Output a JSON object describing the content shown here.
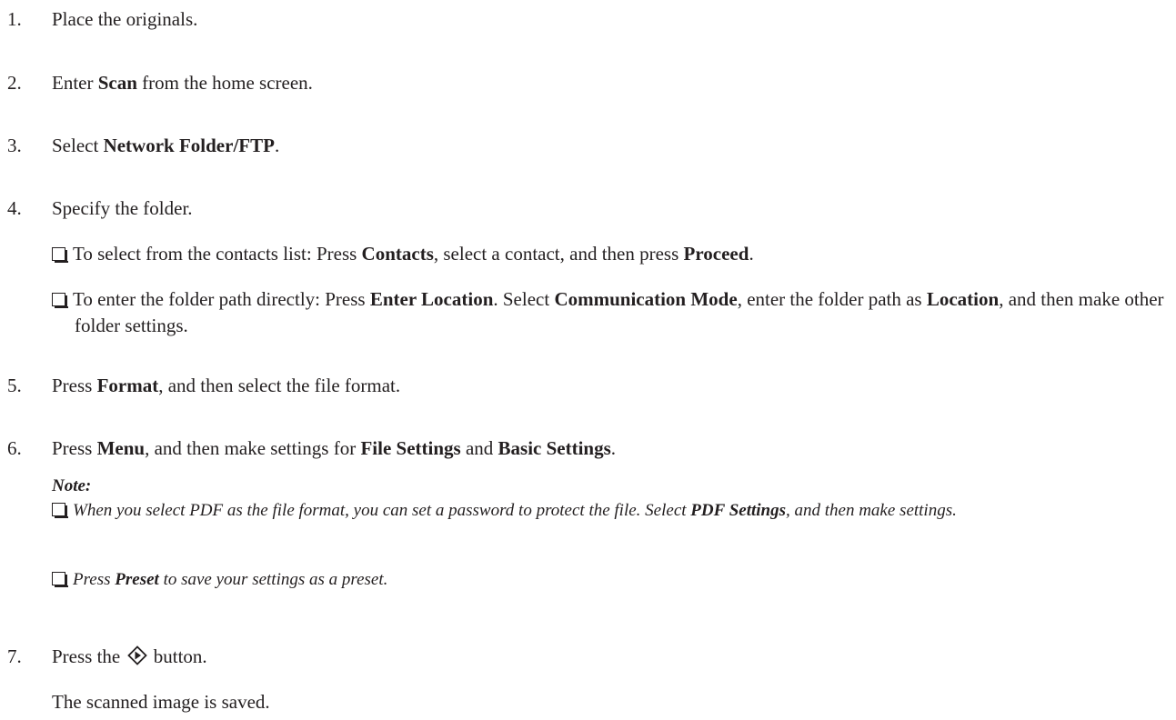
{
  "steps": [
    {
      "num": "1.",
      "text": "Place the originals."
    },
    {
      "num": "2.",
      "a": "Enter ",
      "b": "Scan",
      "c": " from the home screen."
    },
    {
      "num": "3.",
      "a": "Select ",
      "b": "Network Folder/FTP",
      "c": "."
    },
    {
      "num": "4.",
      "text": "Specify the folder."
    },
    {
      "num": "5.",
      "a": "Press ",
      "b": "Format",
      "c": ", and then select the file format."
    },
    {
      "num": "6.",
      "a": "Press ",
      "b": "Menu",
      "c": ", and then make settings for ",
      "d": "File Settings",
      "e": " and ",
      "f": "Basic Settings",
      "g": "."
    },
    {
      "num": "7.",
      "a": "Press the ",
      "icon": "start-button-icon",
      "c": " button.",
      "result": "The scanned image is saved."
    }
  ],
  "step4_options": [
    {
      "a": "To select from the contacts list: Press ",
      "b": "Contacts",
      "c": ", select a contact, and then press ",
      "d": "Proceed",
      "e": "."
    },
    {
      "a": "To enter the folder path directly: Press ",
      "b": "Enter Location",
      "c": ". Select ",
      "d": "Communication Mode",
      "e": ", enter the folder path as ",
      "f": "Location",
      "g": ", and then make other folder settings."
    }
  ],
  "note": {
    "label": "Note:",
    "items": [
      {
        "a": "When you select PDF as the file format, you can set a password to protect the file. Select ",
        "b": "PDF Settings",
        "c": ", and then make settings."
      },
      {
        "a": "Press ",
        "b": "Preset",
        "c": " to save your settings as a preset."
      }
    ]
  }
}
